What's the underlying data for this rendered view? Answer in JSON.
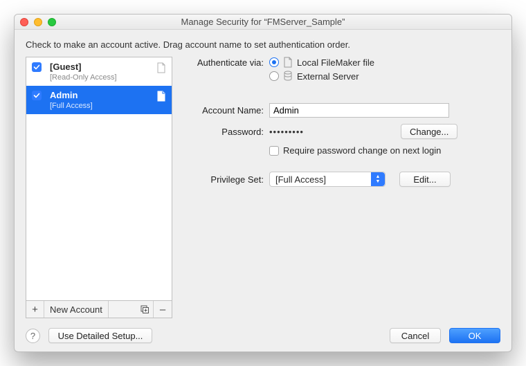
{
  "window": {
    "title": "Manage Security for “FMServer_Sample”"
  },
  "instruction": "Check to make an account active.  Drag account name to set authentication order.",
  "accounts": [
    {
      "name": "[Guest]",
      "privilege": "[Read-Only Access]",
      "checked": true,
      "selected": false
    },
    {
      "name": "Admin",
      "privilege": "[Full Access]",
      "checked": true,
      "selected": true
    }
  ],
  "list_toolbar": {
    "add_label": "+",
    "new_account_label": "New Account",
    "dup_label": "⧉",
    "remove_label": "–"
  },
  "form": {
    "auth_label": "Authenticate via:",
    "auth_options": {
      "local": "Local FileMaker file",
      "external": "External Server"
    },
    "auth_selected": "local",
    "account_name_label": "Account Name:",
    "account_name_value": "Admin",
    "password_label": "Password:",
    "password_dots": "•••••••••",
    "change_btn": "Change...",
    "require_change_label": "Require password change on next login",
    "privilege_set_label": "Privilege Set:",
    "privilege_set_value": "[Full Access]",
    "edit_btn": "Edit..."
  },
  "footer": {
    "detailed_btn": "Use Detailed Setup...",
    "cancel": "Cancel",
    "ok": "OK"
  }
}
